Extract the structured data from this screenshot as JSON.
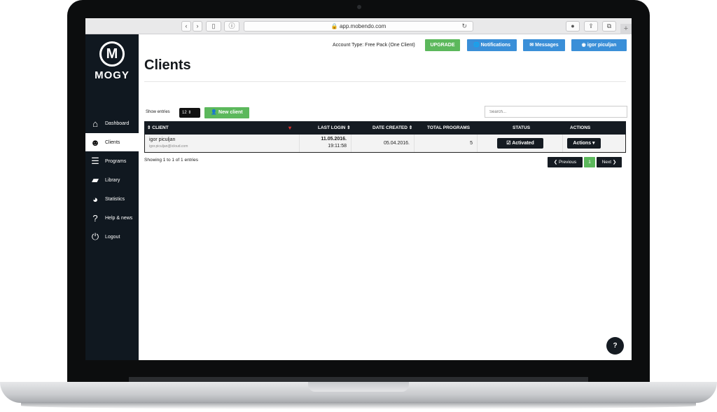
{
  "browser": {
    "url": "app.mobendo.com",
    "back": "‹",
    "forward": "›",
    "sidebar_toggle": "▯",
    "info": "ⓘ",
    "reload": "↻",
    "download": "●",
    "share": "⇪",
    "tabs": "⧉",
    "new_tab": "+"
  },
  "sidebar": {
    "logo_mark": "M",
    "logo_text": "MOGY",
    "items": [
      {
        "label": "Dashboard",
        "icon": "home-icon",
        "glyph": "⌂"
      },
      {
        "label": "Clients",
        "icon": "users-icon",
        "glyph": "☻"
      },
      {
        "label": "Programs",
        "icon": "list-icon",
        "glyph": "☰"
      },
      {
        "label": "Library",
        "icon": "folder-icon",
        "glyph": "▰"
      },
      {
        "label": "Statistics",
        "icon": "pie-chart-icon",
        "glyph": "◕"
      },
      {
        "label": "Help & news",
        "icon": "question-icon",
        "glyph": "?"
      },
      {
        "label": "Logout",
        "icon": "power-icon",
        "glyph": "⏻"
      }
    ],
    "active": "Clients"
  },
  "header": {
    "account_type": "Account Type: Free Pack (One Client)",
    "upgrade": "UPGRADE",
    "notifications": "🌐 Notifications",
    "messages": "✉ Messages",
    "user": "◉ igor piculjan"
  },
  "page": {
    "title": "Clients",
    "show_entries_label": "Show entries",
    "entries_value": "12 ⇕",
    "new_client": "👤 New client",
    "search_placeholder": "Search..."
  },
  "table": {
    "headers": {
      "client": "⇕ CLIENT",
      "last_login": "LAST LOGIN ⇕",
      "date_created": "DATE CREATED ⇕",
      "total_programs": "TOTAL PROGRAMS",
      "status": "STATUS",
      "actions": "ACTIONS"
    },
    "sort_indicator": "▾",
    "rows": [
      {
        "name": "igor piculjan",
        "email": "igor.piculjan@icloud.com",
        "last_login_date": "11.05.2016.",
        "last_login_time": "19:11:58",
        "date_created": "05.04.2016.",
        "total_programs": "5",
        "status": "☑ Activated",
        "actions": "Actions ▾"
      }
    ]
  },
  "footer": {
    "showing": "Showing 1 to 1 of 1 entries",
    "previous": "❮ Previous",
    "page": "1",
    "next": "Next ❯"
  },
  "help_fab": "?",
  "colors": {
    "sidebar_bg": "#101820",
    "upgrade": "#5cb85c",
    "accent_blue": "#3a8fd8",
    "dark": "#151b22",
    "sort_red": "#d9302c"
  }
}
